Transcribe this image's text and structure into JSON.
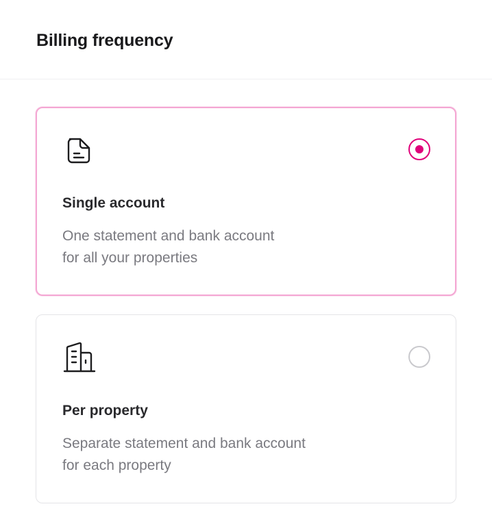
{
  "header": {
    "title": "Billing frequency"
  },
  "options": [
    {
      "icon": "document-icon",
      "title": "Single account",
      "description_lines": [
        "One statement and bank account",
        "for all your properties"
      ],
      "selected": true
    },
    {
      "icon": "building-icon",
      "title": "Per property",
      "description_lines": [
        "Separate statement and bank account",
        "for each property"
      ],
      "selected": false
    }
  ],
  "colors": {
    "accent": "#e0007a",
    "selected_border": "#f4a7d3",
    "unselected_border": "#e4e4e7",
    "description_text": "#7a7a80"
  }
}
